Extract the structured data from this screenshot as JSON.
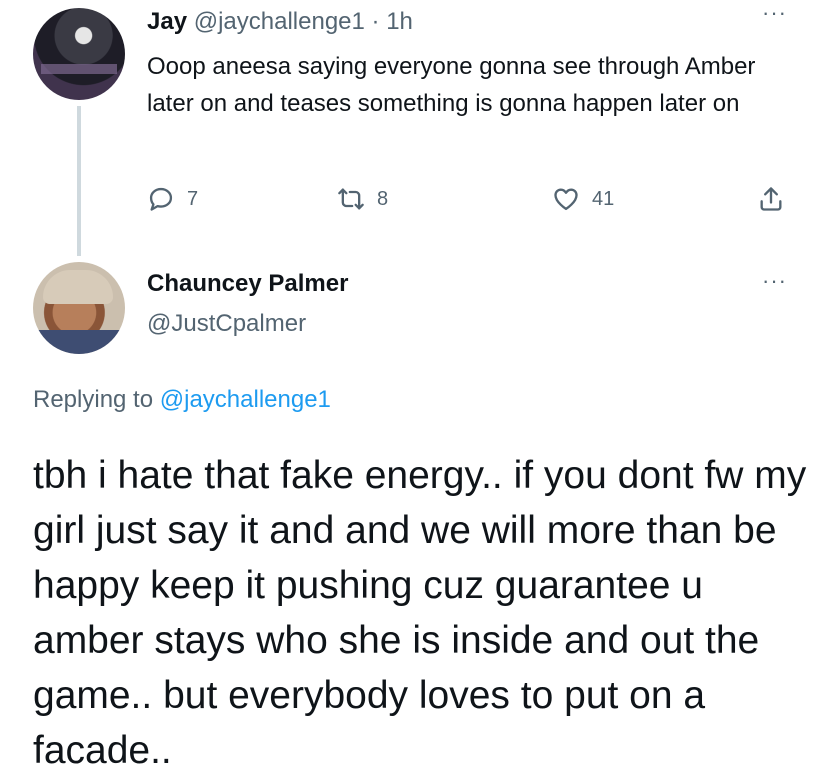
{
  "tweet": {
    "display_name": "Jay",
    "handle": "@jaychallenge1",
    "separator": "·",
    "time": "1h",
    "more": "···",
    "text": "Ooop aneesa saying everyone gonna see through Amber later on and teases something is gonna happen later on",
    "actions": {
      "replies": "7",
      "retweets": "8",
      "likes": "41"
    }
  },
  "reply": {
    "display_name": "Chauncey Palmer",
    "handle": "@JustCpalmer",
    "more": "···",
    "replying_prefix": "Replying to",
    "replying_to": "@jaychallenge1",
    "text": "tbh i hate that fake energy.. if you dont fw my girl just say it and and we will more than be happy keep it pushing cuz guarantee u amber stays who she is inside and out the game.. but everybody loves to put on a facade.."
  },
  "icons": {
    "reply": "comment-icon",
    "retweet": "retweet-icon",
    "like": "heart-icon",
    "share": "share-icon",
    "more": "more-icon"
  },
  "colors": {
    "text": "#0f1419",
    "secondary": "#536471",
    "link": "#1d9bf0",
    "thread_line": "#cfd9de"
  }
}
